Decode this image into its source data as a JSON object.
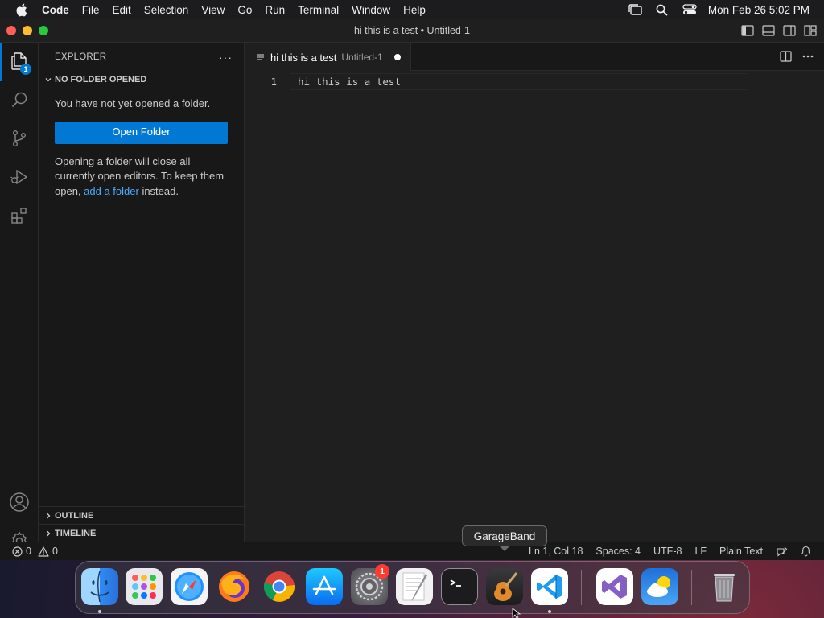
{
  "menubar": {
    "app_name": "Code",
    "items": [
      "File",
      "Edit",
      "Selection",
      "View",
      "Go",
      "Run",
      "Terminal",
      "Window",
      "Help"
    ],
    "clock": "Mon Feb 26  5:02 PM"
  },
  "window": {
    "title": "hi this is a test • Untitled-1"
  },
  "activitybar": {
    "explorer_badge": "1"
  },
  "sidebar": {
    "title": "EXPLORER",
    "more": "···",
    "section_title": "NO FOLDER OPENED",
    "message": "You have not yet opened a folder.",
    "open_folder_button": "Open Folder",
    "info_prefix": "Opening a folder will close all currently open editors. To keep them open, ",
    "info_link": "add a folder",
    "info_suffix": " instead.",
    "outline_title": "OUTLINE",
    "timeline_title": "TIMELINE"
  },
  "editor": {
    "tab_name": "hi this is a test",
    "tab_description": "Untitled-1",
    "line_number": "1",
    "line_text": "hi this is a test"
  },
  "statusbar": {
    "errors": "0",
    "warnings": "0",
    "position": "Ln 1, Col 18",
    "spaces": "Spaces: 4",
    "encoding": "UTF-8",
    "eol": "LF",
    "language": "Plain Text"
  },
  "tooltip": {
    "text": "GarageBand"
  },
  "dock": {
    "settings_badge": "1",
    "apps": [
      "finder",
      "launchpad",
      "safari",
      "firefox",
      "chrome",
      "app-store",
      "system-settings",
      "textedit",
      "terminal",
      "garageband",
      "vscode",
      "visual-studio",
      "weather",
      "trash"
    ]
  },
  "colors": {
    "accent": "#0078d4",
    "link": "#4daafc",
    "badge_red": "#ff3b30"
  }
}
